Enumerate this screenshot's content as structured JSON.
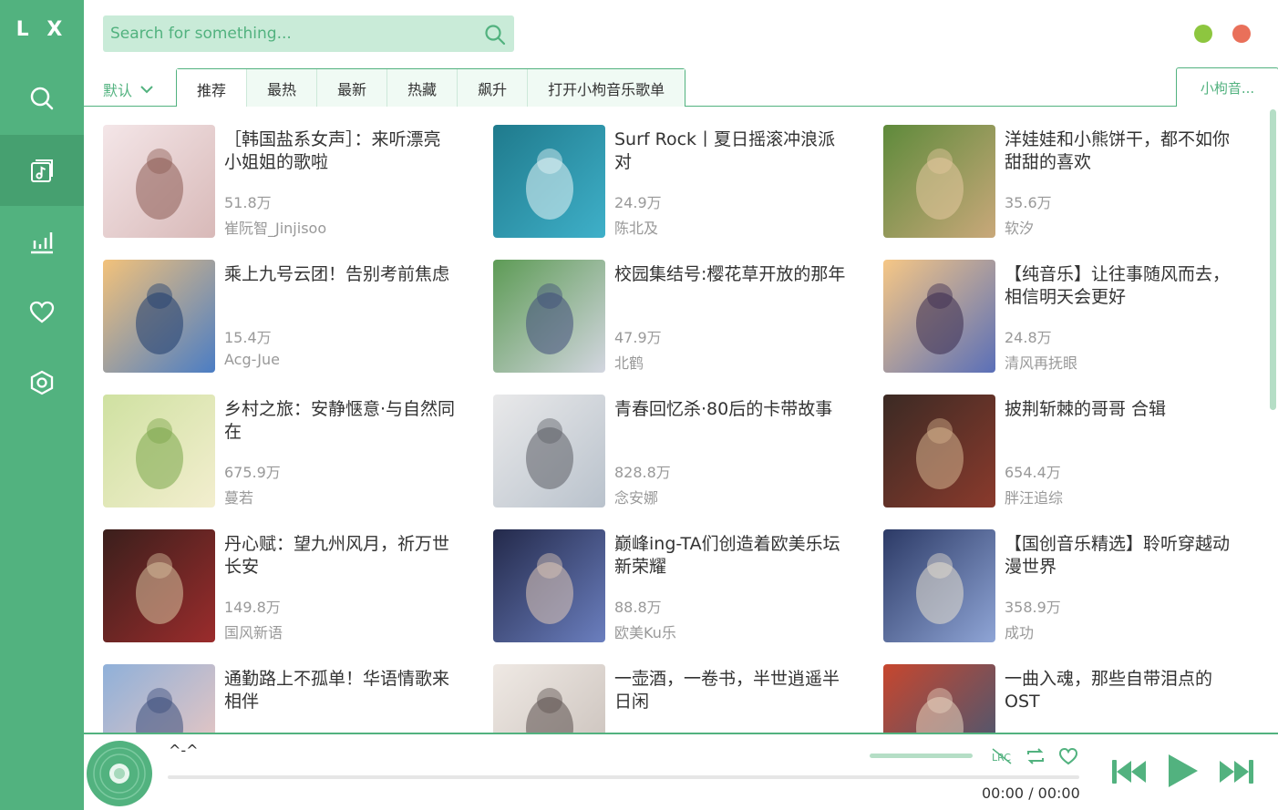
{
  "app": {
    "logo": "L X"
  },
  "sidebar": {
    "items": [
      {
        "name": "search",
        "icon": "search-icon"
      },
      {
        "name": "songlist",
        "icon": "music-list-icon",
        "active": true
      },
      {
        "name": "leaderboard",
        "icon": "chart-icon"
      },
      {
        "name": "favorites",
        "icon": "heart-icon"
      },
      {
        "name": "settings",
        "icon": "settings-icon"
      }
    ]
  },
  "search": {
    "placeholder": "Search for something..."
  },
  "window": {
    "minimize_color": "#8dc63f",
    "close_color": "#e9705a"
  },
  "tabs": {
    "sort_label": "默认",
    "items": [
      "推荐",
      "最热",
      "最新",
      "热藏",
      "飙升",
      "打开小枸音乐歌单"
    ],
    "active_index": 0,
    "source_label": "小枸音..."
  },
  "playlists": [
    {
      "title": "［韩国盐系女声］：来听漂亮小姐姐的歌啦",
      "plays": "51.8万",
      "author": "崔阮智_Jinjisoo"
    },
    {
      "title": "Surf Rock丨夏日摇滚冲浪派对",
      "plays": "24.9万",
      "author": "陈北及"
    },
    {
      "title": "洋娃娃和小熊饼干，都不如你甜甜的喜欢",
      "plays": "35.6万",
      "author": "软汐"
    },
    {
      "title": "乘上九号云团！告别考前焦虑",
      "plays": "15.4万",
      "author": "Acg-Jue"
    },
    {
      "title": "校园集结号:樱花草开放的那年",
      "plays": "47.9万",
      "author": "北鹤"
    },
    {
      "title": "【纯音乐】让往事随风而去，相信明天会更好",
      "plays": "24.8万",
      "author": "清风再抚眼"
    },
    {
      "title": "乡村之旅：安静惬意·与自然同在",
      "plays": "675.9万",
      "author": "蔓若"
    },
    {
      "title": "青春回忆杀·80后的卡带故事",
      "plays": "828.8万",
      "author": "念安娜"
    },
    {
      "title": "披荆斩棘的哥哥 合辑",
      "plays": "654.4万",
      "author": "胖汪追综"
    },
    {
      "title": "丹心赋：望九州风月，祈万世长安",
      "plays": "149.8万",
      "author": "国风新语"
    },
    {
      "title": "巅峰ing-TA们创造着欧美乐坛新荣耀",
      "plays": "88.8万",
      "author": "欧美Ku乐"
    },
    {
      "title": "【国创音乐精选】聆听穿越动漫世界",
      "plays": "358.9万",
      "author": "成功"
    },
    {
      "title": "通勤路上不孤单！华语情歌来相伴",
      "plays": "",
      "author": ""
    },
    {
      "title": "一壶酒，一卷书，半世逍遥半日闲",
      "plays": "",
      "author": ""
    },
    {
      "title": "一曲入魂，那些自带泪点的OST",
      "plays": "",
      "author": ""
    }
  ],
  "player": {
    "song_name": "^-^",
    "time": "00:00 / 00:00",
    "lrc_label": "LRC",
    "progress": 0,
    "accent": "#52b27f"
  }
}
